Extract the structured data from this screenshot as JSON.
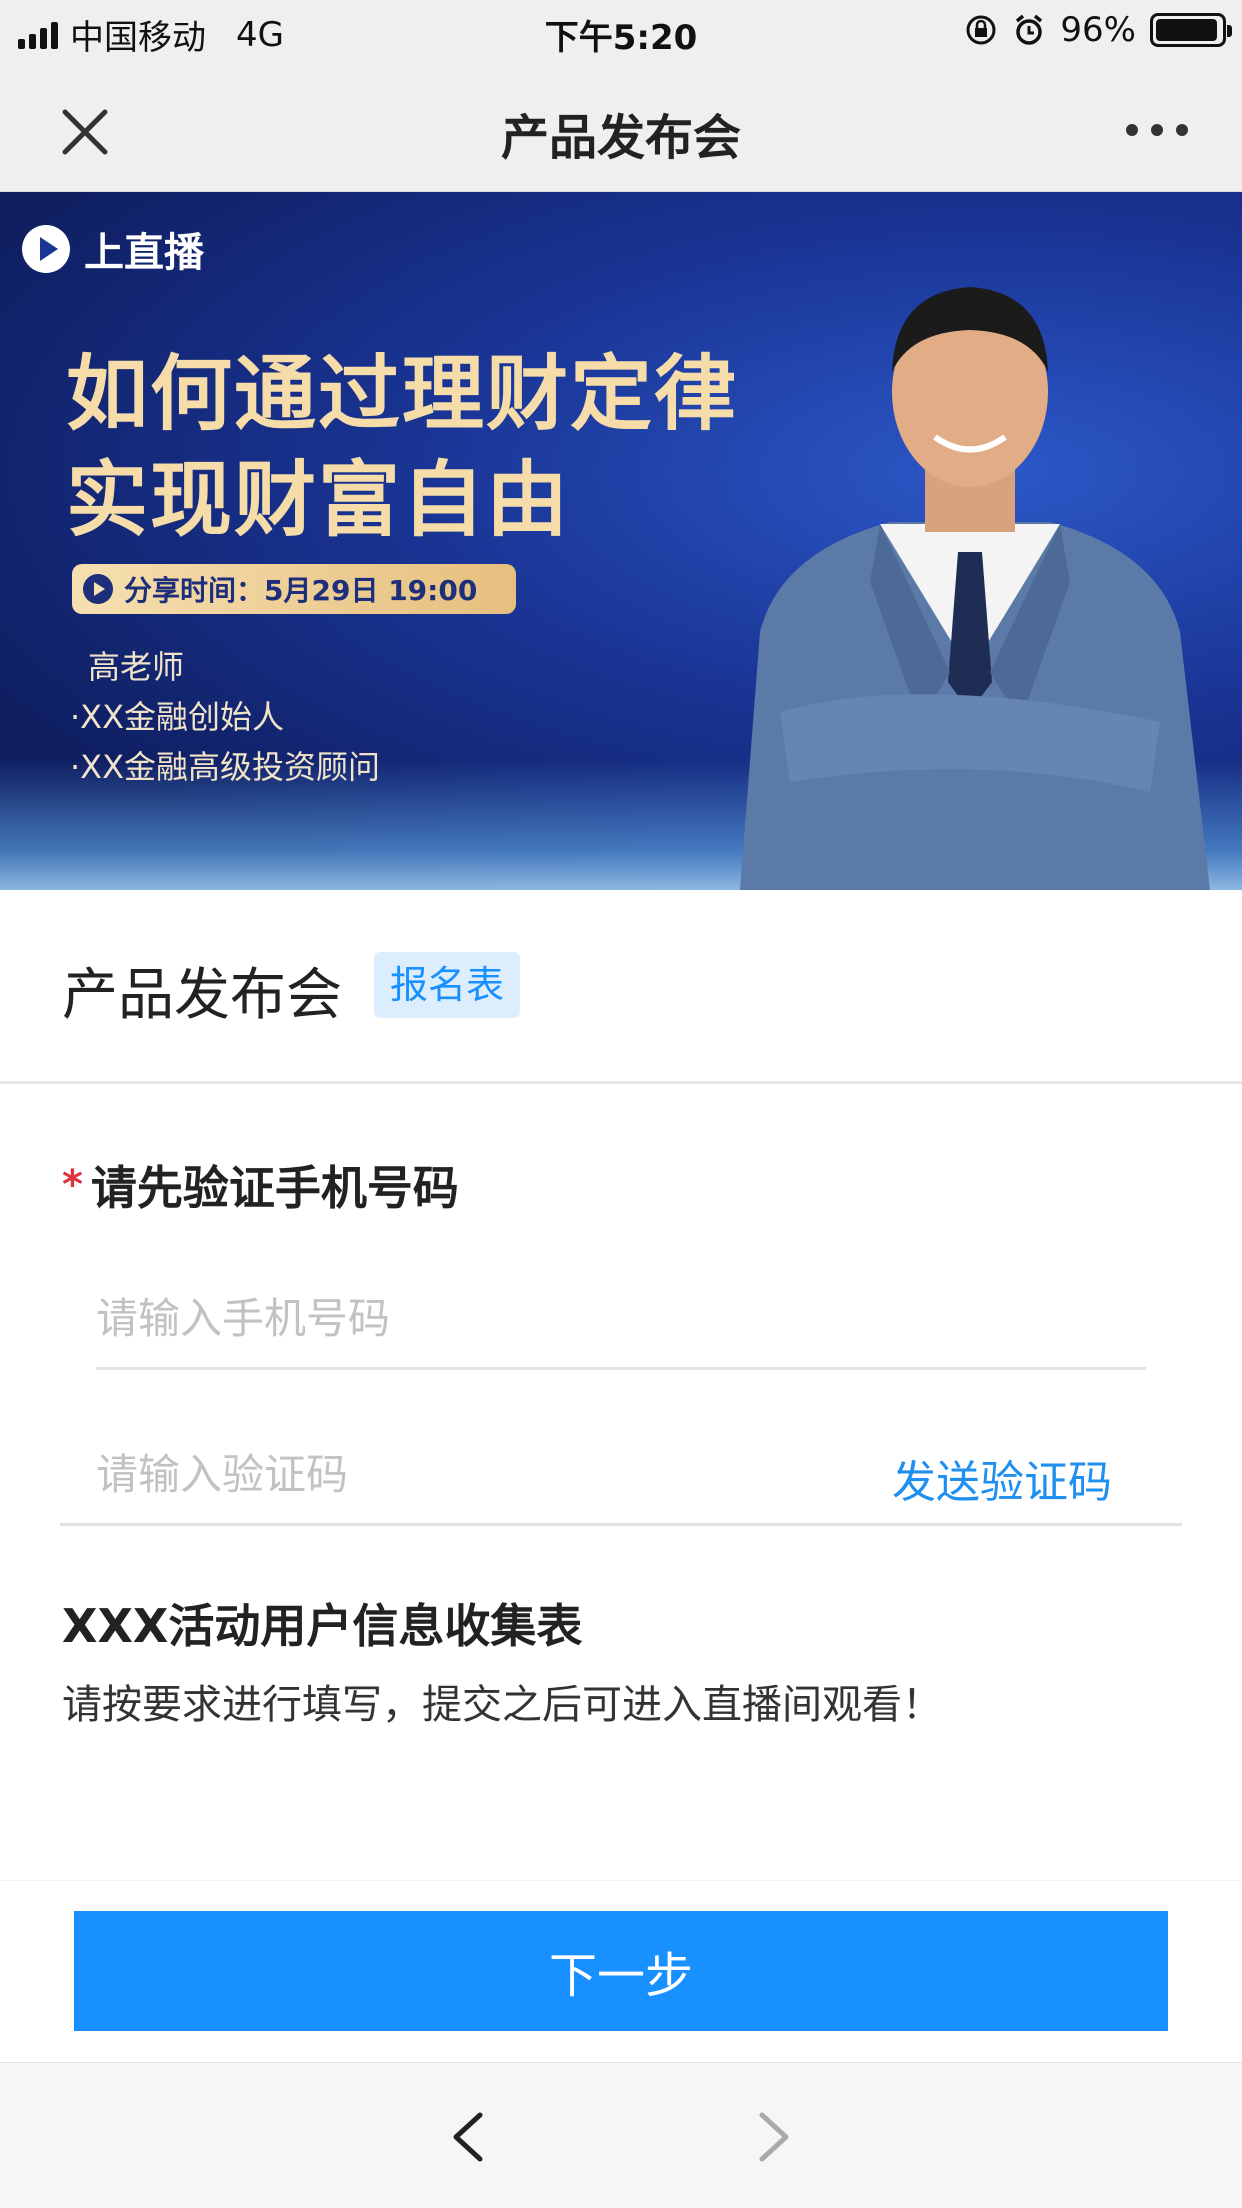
{
  "status_bar": {
    "carrier": "中国移动",
    "network": "4G",
    "time": "下午5:20",
    "battery": "96%",
    "battery_level": 0.96
  },
  "nav": {
    "title": "产品发布会",
    "close_icon": "close-icon",
    "more_icon": "more-dots-icon"
  },
  "banner": {
    "brand": "上直播",
    "headline_line1": "如何通过理财定律",
    "headline_line2": "实现财富自由",
    "share_time": "分享时间：5月29日 19:00",
    "teacher_name": "高老师",
    "teacher_title1": "·XX金融创始人",
    "teacher_title2": "·XX金融高级投资顾问"
  },
  "form": {
    "title": "产品发布会",
    "tag": "报名表",
    "required_mark": "*",
    "verify_label": "请先验证手机号码",
    "phone_placeholder": "请输入手机号码",
    "code_placeholder": "请输入验证码",
    "send_code": "发送验证码",
    "info_title": "XXX活动用户信息收集表",
    "info_desc": "请按要求进行填写，提交之后可进入直播间观看！",
    "next_button": "下一步"
  },
  "toolbar": {
    "back_icon": "chevron-left-icon",
    "forward_icon": "chevron-right-icon"
  },
  "colors": {
    "primary": "#1890ff",
    "required": "#e0323c",
    "tag_bg": "#dcedfd",
    "banner_bg": "#1a3596",
    "banner_text": "#f5dca8"
  }
}
